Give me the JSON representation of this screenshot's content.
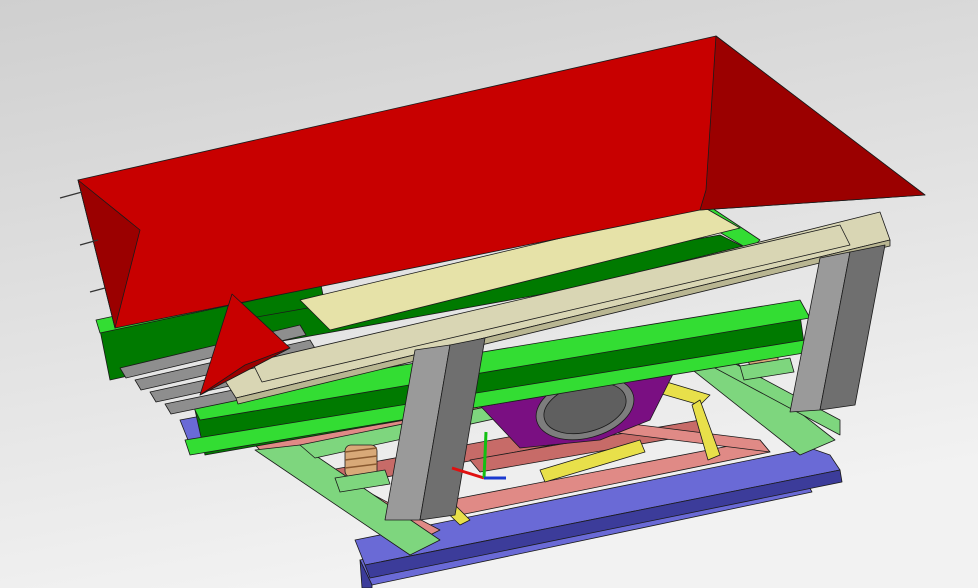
{
  "viewport": {
    "background_top": "#cfcfcf",
    "background_bottom": "#f2f2f2"
  },
  "model": {
    "colors": {
      "hopper_red": "#c80000",
      "hopper_red_dark": "#9b0000",
      "deck_green": "#007a00",
      "deck_green_bright": "#33dd33",
      "frame_light_green": "#7ed67e",
      "frame_pink": "#e08a86",
      "frame_rose": "#c76b68",
      "base_blue": "#6a6ad6",
      "base_blue_dark": "#3c3c9a",
      "liner_cream": "#e6e2a8",
      "rail_beige": "#d9d6b4",
      "column_grey": "#9a9a9a",
      "motor_purple": "#7a0f82",
      "motor_grey": "#7d7d7d",
      "brace_yellow": "#e8e04a",
      "spring_tan": "#d8a978",
      "axis_x": "#e01010",
      "axis_y": "#12c012",
      "axis_z": "#1a3ad0"
    },
    "triad_icon": "coordinate-triad-icon"
  }
}
